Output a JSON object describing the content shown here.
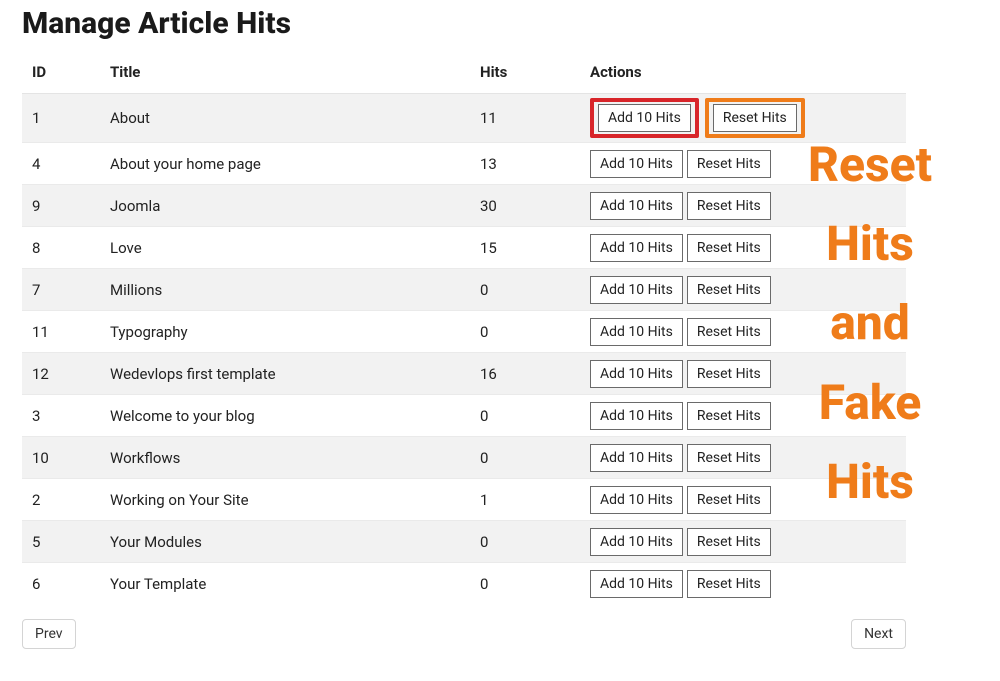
{
  "page": {
    "title": "Manage Article Hits"
  },
  "columns": {
    "id": "ID",
    "title": "Title",
    "hits": "Hits",
    "actions": "Actions"
  },
  "buttons": {
    "add": "Add 10 Hits",
    "reset": "Reset Hits",
    "prev": "Prev",
    "next": "Next"
  },
  "rows": [
    {
      "id": "1",
      "title": "About",
      "hits": "11"
    },
    {
      "id": "4",
      "title": "About your home page",
      "hits": "13"
    },
    {
      "id": "9",
      "title": "Joomla",
      "hits": "30"
    },
    {
      "id": "8",
      "title": "Love",
      "hits": "15"
    },
    {
      "id": "7",
      "title": "Millions",
      "hits": "0"
    },
    {
      "id": "11",
      "title": "Typography",
      "hits": "0"
    },
    {
      "id": "12",
      "title": "Wedevlops first template",
      "hits": "16"
    },
    {
      "id": "3",
      "title": "Welcome to your blog",
      "hits": "0"
    },
    {
      "id": "10",
      "title": "Workflows",
      "hits": "0"
    },
    {
      "id": "2",
      "title": "Working on Your Site",
      "hits": "1"
    },
    {
      "id": "5",
      "title": "Your Modules",
      "hits": "0"
    },
    {
      "id": "6",
      "title": "Your Template",
      "hits": "0"
    }
  ],
  "overlay": {
    "line1": "Reset",
    "line2": "Hits",
    "line3": "and",
    "line4": "Fake",
    "line5": "Hits"
  }
}
